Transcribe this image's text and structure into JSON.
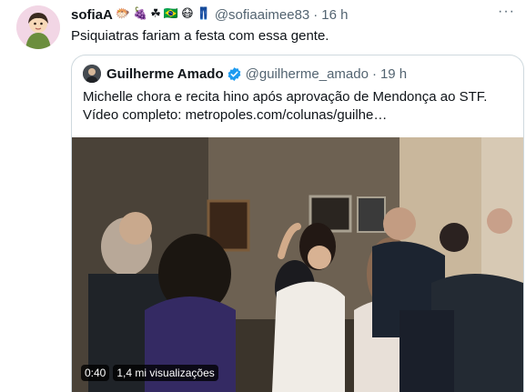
{
  "tweet": {
    "author_name": "sofiaA",
    "emojis": [
      "🐡",
      "🍇",
      "☘",
      "🇧🇷",
      "😷",
      "👖"
    ],
    "handle": "@sofiaaimee83",
    "separator": "·",
    "time": "16 h",
    "more_label": "···",
    "text": "Psiquiatras fariam a festa com essa gente."
  },
  "quoted": {
    "author_name": "Guilherme Amado",
    "handle": "@guilherme_amado",
    "separator": "·",
    "time": "19 h",
    "line1": "Michelle chora e recita hino após aprovação de Mendonça ao STF.",
    "line2_prefix": "Vídeo completo: ",
    "link": "metropoles.com/colunas/guilhe…",
    "video": {
      "duration": "0:40",
      "views": "1,4 mi visualizações"
    }
  },
  "colors": {
    "text": "#0f1419",
    "secondary": "#536471",
    "border": "#cfd9de",
    "verified": "#1d9bf0"
  },
  "icons": [
    "avatar-icon",
    "more-icon",
    "verified-badge-icon"
  ]
}
